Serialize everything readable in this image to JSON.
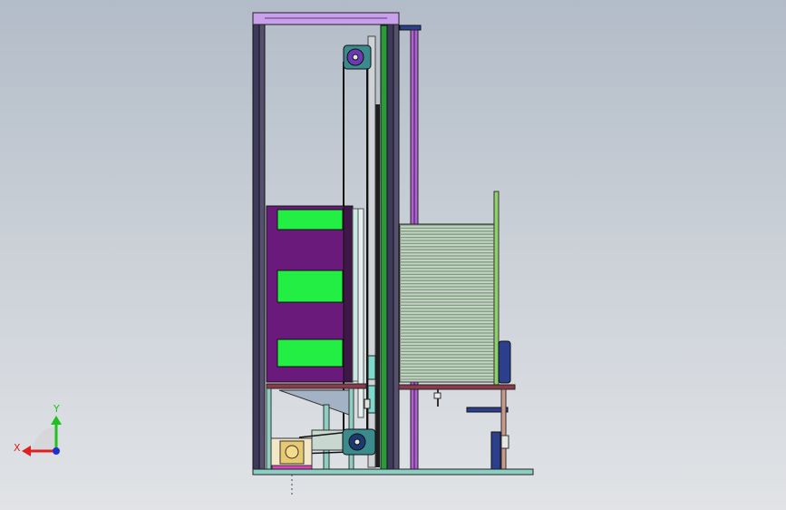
{
  "viewport": {
    "background_top": "#b2bcc8",
    "background_bottom": "#e1e3e6"
  },
  "model": {
    "frame_color": "#3d3a5c",
    "top_beam_color": "#c9a0ea",
    "bar_color": "#2a9a3a",
    "rod_color": "#b060d0",
    "tray_body_color": "#6a1a7a",
    "tray_window_color": "#22ee44",
    "stack_color": "#7aa07a",
    "pulley_color": "#3b8a8e",
    "shelf_color": "#8a3a4a",
    "base_color": "#8ecfc4",
    "motor_color": "#f2e8c8",
    "accent_blue": "#2b3f8c"
  },
  "triad": {
    "x_label": "X",
    "y_label": "Y",
    "x_color": "#e02020",
    "y_color": "#20c020",
    "origin_color": "#2030d0"
  }
}
